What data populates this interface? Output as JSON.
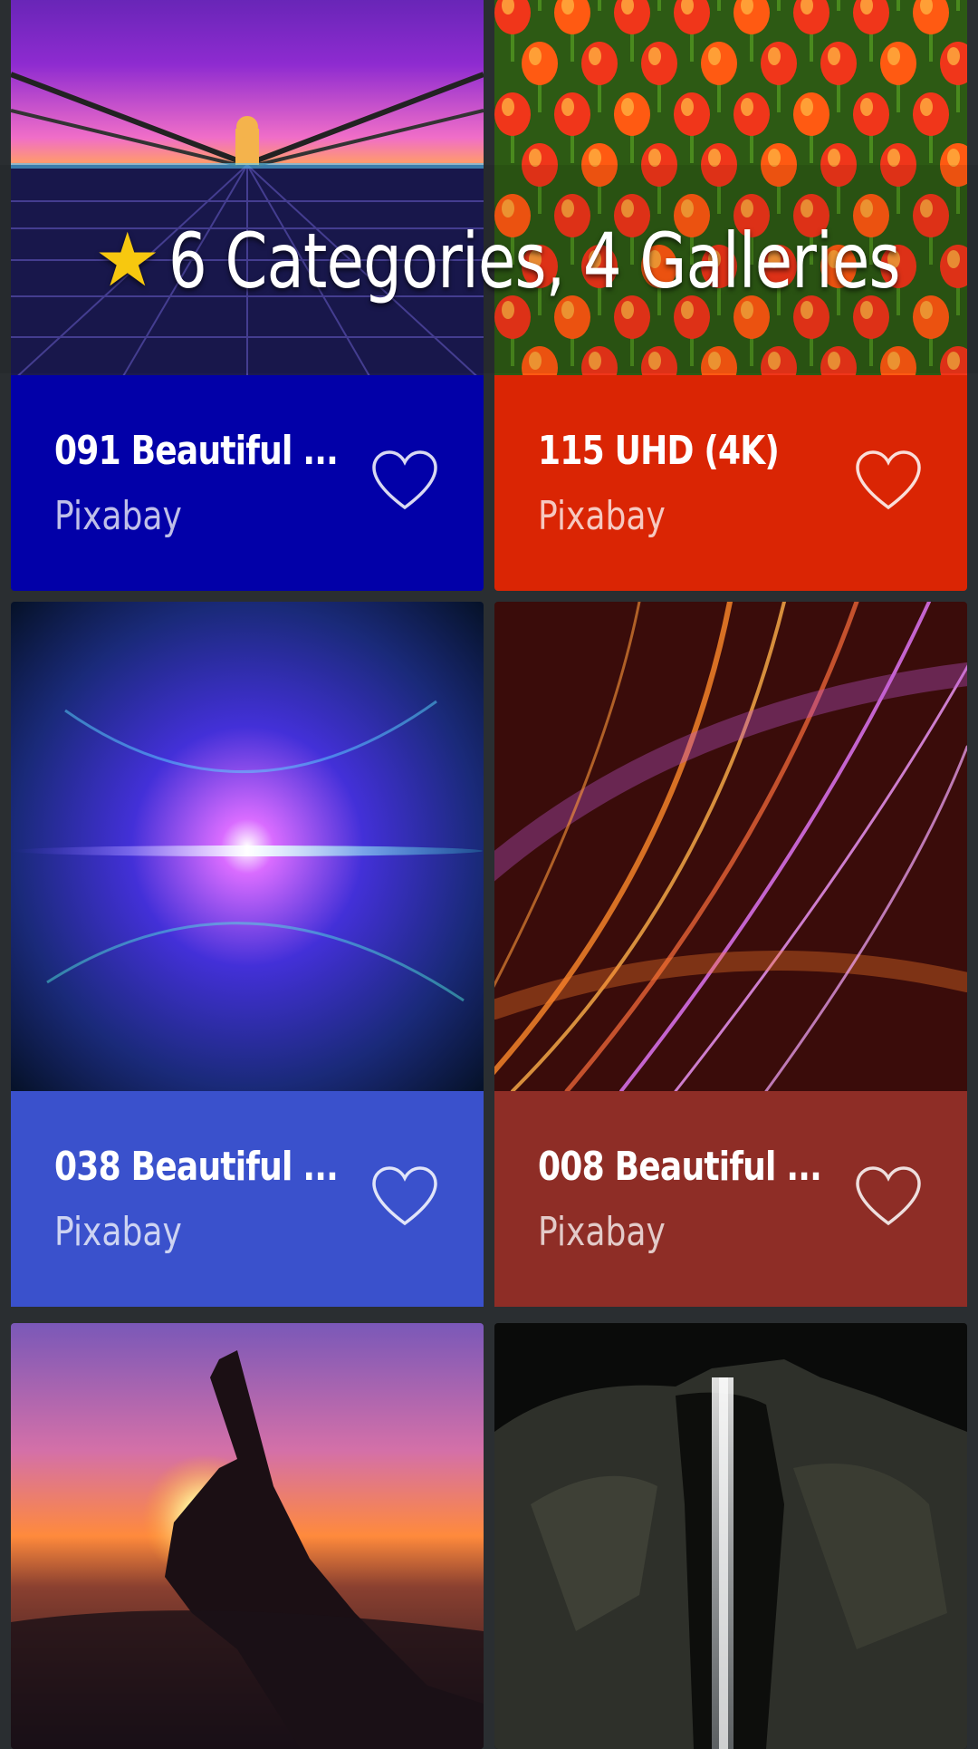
{
  "banner": {
    "star_icon": "star-icon",
    "text": "6 Categories, 4 Galleries"
  },
  "cards": [
    {
      "title": "091 Beautiful ...",
      "source": "Pixabay",
      "color": "#0200a8",
      "image": "bridge-sunset-photo"
    },
    {
      "title": "115 UHD (4K)",
      "source": "Pixabay",
      "color": "#da2504",
      "image": "tulips-photo"
    },
    {
      "title": "038 Beautiful ...",
      "source": "Pixabay",
      "color": "#3a51cc",
      "image": "particle-wave-photo"
    },
    {
      "title": "008 Beautiful ...",
      "source": "Pixabay",
      "color": "#8e2d26",
      "image": "light-streaks-photo"
    },
    {
      "title": "",
      "source": "",
      "color": "#1a1a24",
      "image": "hand-sunset-photo"
    },
    {
      "title": "",
      "source": "",
      "color": "#111111",
      "image": "cave-waterfall-photo"
    }
  ],
  "icons": {
    "favorite": "heart-outline-icon"
  }
}
